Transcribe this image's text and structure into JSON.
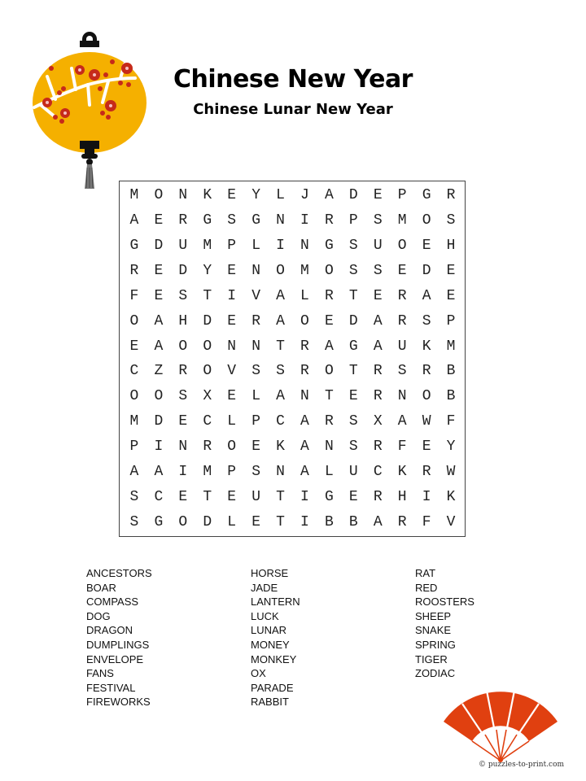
{
  "header": {
    "title": "Chinese New Year",
    "subtitle": "Chinese Lunar New Year"
  },
  "icons": {
    "lantern": "lantern-icon",
    "fan": "fan-icon"
  },
  "colors": {
    "lantern_body": "#f5b000",
    "blossom": "#c62a1a",
    "fan": "#e04010"
  },
  "grid": {
    "rows": [
      "MONKEYLJADEPGR",
      "AERGSGNIRPSMOS",
      "GDUMPLINGSUOEH",
      "REDYENOMOSSEDE",
      "FESTIVALRTERAE",
      "OAHDERAOEDARSP",
      "EAOONNTRAGAUKM",
      "CZROVSSROTRSRB",
      "OOSXELANTERNOB",
      "MDECLPCARSXAWF",
      "PINROEKANSRFEY",
      "AAIMPSNALUCKRW",
      "SCETEUTIGERHIK",
      "SGODLETIBBARFV"
    ]
  },
  "word_list": {
    "columns": [
      [
        "ANCESTORS",
        "BOAR",
        "COMPASS",
        "DOG",
        "DRAGON",
        "DUMPLINGS",
        "ENVELOPE",
        "FANS",
        "FESTIVAL",
        "FIREWORKS"
      ],
      [
        "HORSE",
        "JADE",
        "LANTERN",
        "LUCK",
        "LUNAR",
        "MONEY",
        "MONKEY",
        "OX",
        "PARADE",
        "RABBIT"
      ],
      [
        "RAT",
        "RED",
        "ROOSTERS",
        "SHEEP",
        "SNAKE",
        "SPRING",
        "TIGER",
        "ZODIAC"
      ]
    ]
  },
  "footer": {
    "copyright": "© puzzles-to-print.com"
  }
}
